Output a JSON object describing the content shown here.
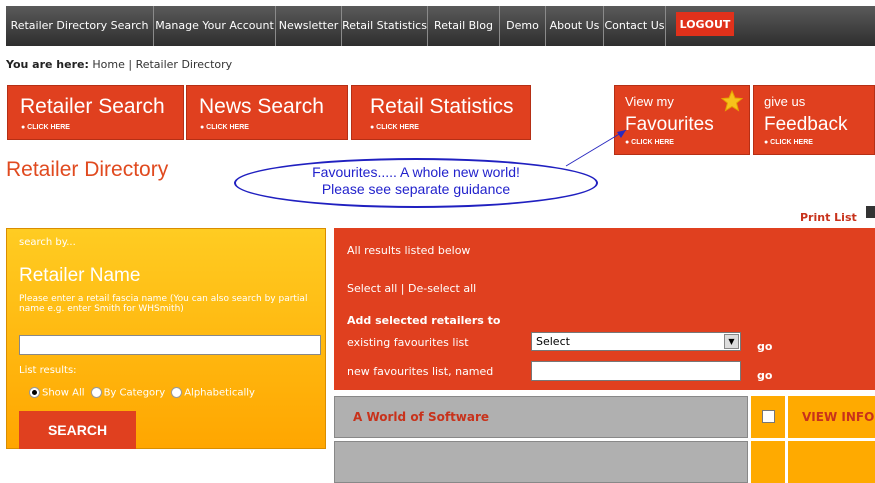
{
  "nav": {
    "items": [
      {
        "label": "Retailer Directory Search"
      },
      {
        "label": "Manage Your Account"
      },
      {
        "label": "Newsletter"
      },
      {
        "label": "Retail Statistics"
      },
      {
        "label": "Retail Blog"
      },
      {
        "label": "Demo"
      },
      {
        "label": "About Us"
      },
      {
        "label": "Contact Us"
      }
    ],
    "logout": "LOGOUT"
  },
  "breadcrumb": {
    "prefix": "You are here:",
    "path": "Home | Retailer Directory"
  },
  "buttons": {
    "retailer_search": {
      "title": "Retailer Search",
      "cta": "● CLICK HERE"
    },
    "news_search": {
      "title": "News Search",
      "cta": "● CLICK HERE"
    },
    "retail_statistics": {
      "title": "Retail Statistics",
      "cta": "● CLICK HERE"
    },
    "favourites": {
      "line1": "View my",
      "line2": "Favourites",
      "cta": "● CLICK HERE"
    },
    "feedback": {
      "line1": "give us",
      "line2": "Feedback",
      "cta": "● CLICK HERE"
    }
  },
  "page_title": "Retailer Directory",
  "callout": {
    "line1": "Favourites..... A whole new world!",
    "line2": "Please see separate guidance"
  },
  "print_list": "Print List",
  "search": {
    "by": "search by...",
    "title": "Retailer Name",
    "help": "Please enter a retail fascia name (You can also search by partial name e.g. enter Smith for WHSmith)",
    "list_results": "List results:",
    "radios": [
      "Show All",
      "By Category",
      "Alphabetically"
    ],
    "selected_radio": "Show All",
    "button": "SEARCH"
  },
  "results": {
    "all_listed": "All results listed below",
    "select_all": "Select all | De-select all",
    "add_selected": "Add selected retailers to",
    "existing": "existing favourites list",
    "select_value": "Select",
    "new_list": "new favourites list, named",
    "go": "go"
  },
  "rows": [
    {
      "name": "A World of Software",
      "view": "VIEW INFO"
    },
    {
      "name": "",
      "view": ""
    }
  ]
}
